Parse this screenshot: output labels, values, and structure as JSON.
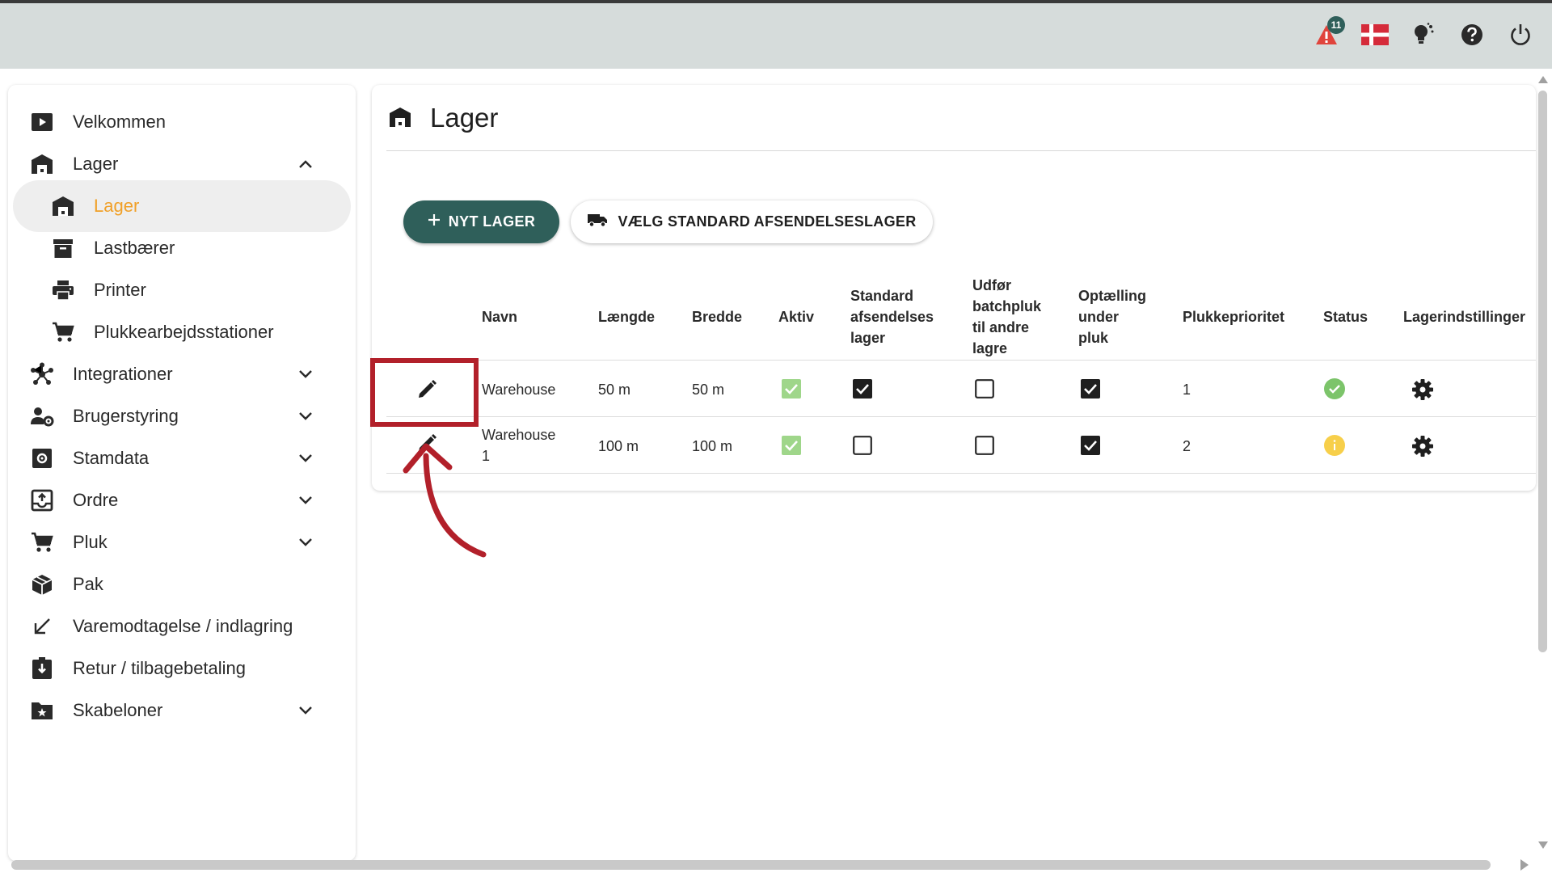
{
  "header": {
    "notification_count": "11",
    "icons": [
      "alert-icon",
      "danish-flag-icon",
      "lightbulb-icon",
      "help-icon",
      "power-icon"
    ]
  },
  "sidebar": {
    "items": [
      {
        "label": "Velkommen",
        "icon": "play-icon",
        "type": "top"
      },
      {
        "label": "Lager",
        "icon": "warehouse-icon",
        "type": "top",
        "expanded": true
      },
      {
        "label": "Lager",
        "icon": "warehouse-icon",
        "type": "sub",
        "active": true
      },
      {
        "label": "Lastbærer",
        "icon": "archive-icon",
        "type": "sub"
      },
      {
        "label": "Printer",
        "icon": "printer-icon",
        "type": "sub"
      },
      {
        "label": "Plukkearbejdsstationer",
        "icon": "cart-icon",
        "type": "sub"
      },
      {
        "label": "Integrationer",
        "icon": "hub-icon",
        "type": "top",
        "collapsible": true
      },
      {
        "label": "Brugerstyring",
        "icon": "user-settings-icon",
        "type": "top",
        "collapsible": true
      },
      {
        "label": "Stamdata",
        "icon": "settings-box-icon",
        "type": "top",
        "collapsible": true
      },
      {
        "label": "Ordre",
        "icon": "inbox-upload-icon",
        "type": "top",
        "collapsible": true
      },
      {
        "label": "Pluk",
        "icon": "cart-icon",
        "type": "top",
        "collapsible": true
      },
      {
        "label": "Pak",
        "icon": "package-icon",
        "type": "top"
      },
      {
        "label": "Varemodtagelse / indlagring",
        "icon": "arrow-down-left-icon",
        "type": "top"
      },
      {
        "label": "Retur / tilbagebetaling",
        "icon": "return-box-icon",
        "type": "top"
      },
      {
        "label": "Skabeloner",
        "icon": "folder-star-icon",
        "type": "top",
        "collapsible": true
      }
    ]
  },
  "main": {
    "title": "Lager",
    "new_button": "NYT LAGER",
    "default_button": "VÆLG STANDARD AFSENDELSESLAGER",
    "columns": {
      "navn": "Navn",
      "laengde": "Længde",
      "bredde": "Bredde",
      "aktiv": "Aktiv",
      "standard": [
        "Standard",
        "afsendelses",
        "lager"
      ],
      "batch": [
        "Udfør",
        "batchpluk",
        "til andre",
        "lagre"
      ],
      "optaelling": [
        "Optælling",
        "under",
        "pluk"
      ],
      "prioritet": "Plukkeprioritet",
      "status": "Status",
      "indstillinger": "Lagerindstillinger"
    },
    "rows": [
      {
        "navn": [
          "Warehouse"
        ],
        "laengde": "50 m",
        "bredde": "50 m",
        "aktiv": true,
        "standard": true,
        "batch": false,
        "optaelling": true,
        "prioritet": "1",
        "status": "ok",
        "status_color": "#7cc46a"
      },
      {
        "navn": [
          "Warehouse",
          "1"
        ],
        "laengde": "100 m",
        "bredde": "100 m",
        "aktiv": true,
        "standard": false,
        "batch": false,
        "optaelling": true,
        "prioritet": "2",
        "status": "warning",
        "status_color": "#f7cf4a"
      }
    ]
  },
  "colors": {
    "primary": "#2f5f5a",
    "active_text": "#f0a028",
    "highlight": "#b2202a",
    "appbar": "#d6dcdb"
  }
}
